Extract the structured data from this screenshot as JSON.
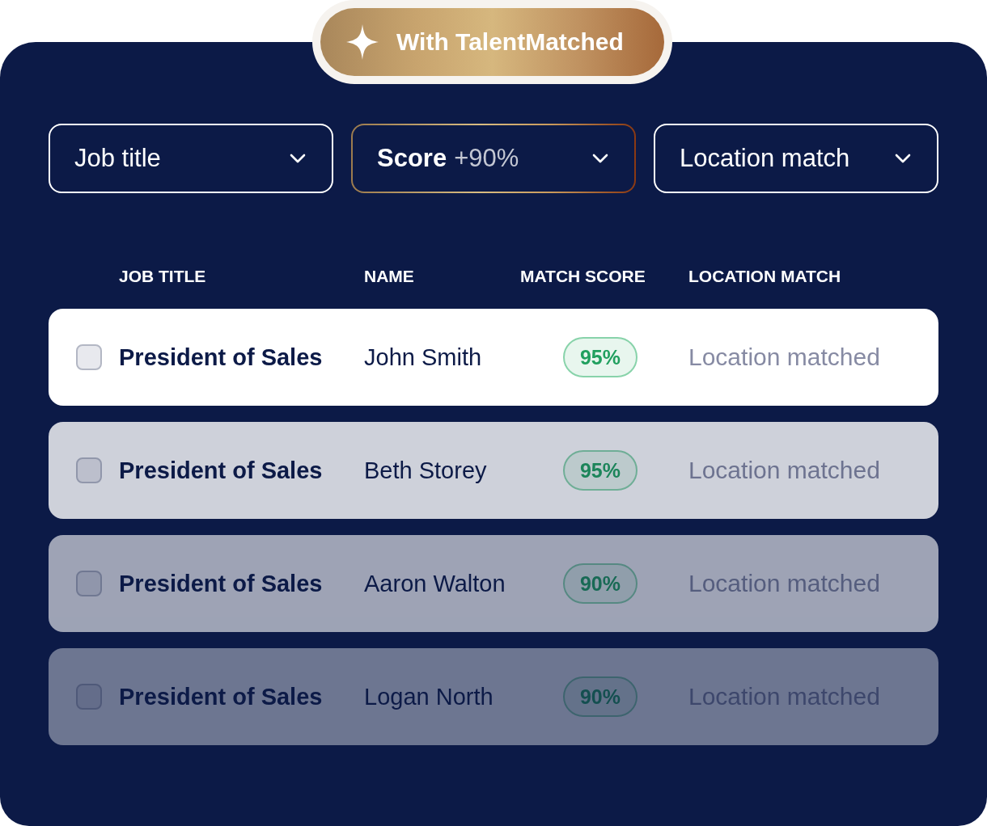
{
  "header_badge": {
    "label": "With TalentMatched"
  },
  "filters": [
    {
      "label": "Job title",
      "highlighted": false
    },
    {
      "label": "Score",
      "value": "+90%",
      "highlighted": true
    },
    {
      "label": "Location match",
      "highlighted": false
    }
  ],
  "table": {
    "columns": [
      "JOB TITLE",
      "NAME",
      "MATCH SCORE",
      "LOCATION MATCH"
    ],
    "rows": [
      {
        "checked": false,
        "job_title": "President of Sales",
        "name": "John Smith",
        "match_score": "95%",
        "location_match": "Location matched"
      },
      {
        "checked": false,
        "job_title": "President of Sales",
        "name": "Beth Storey",
        "match_score": "95%",
        "location_match": "Location matched"
      },
      {
        "checked": false,
        "job_title": "President of Sales",
        "name": "Aaron Walton",
        "match_score": "90%",
        "location_match": "Location matched"
      },
      {
        "checked": false,
        "job_title": "President of Sales",
        "name": "Logan North",
        "match_score": "90%",
        "location_match": "Location matched"
      }
    ]
  }
}
